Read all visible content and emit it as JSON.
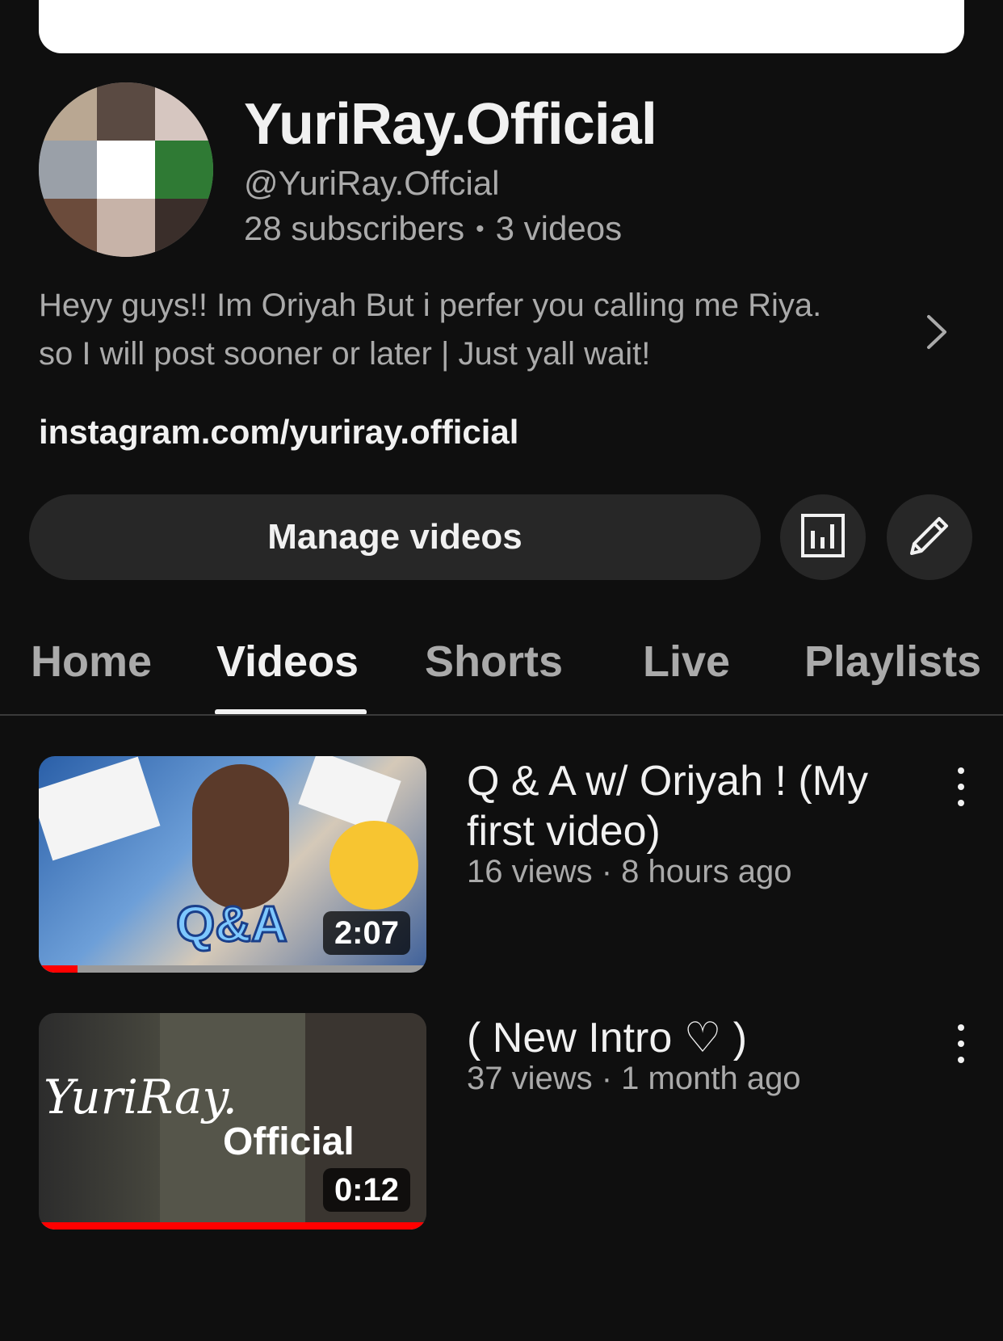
{
  "channel": {
    "name": "YuriRay.Official",
    "handle": "@YuriRay.Offcial",
    "subscribers": "28 subscribers",
    "separator": "•",
    "videos": "3 videos",
    "description": "Heyy guys!! Im Oriyah But i perfer you calling me Riya. so I will post sooner or later | Just yall wait!",
    "link": "instagram.com/yuriray.official"
  },
  "actions": {
    "manage_videos": "Manage videos",
    "analytics_icon": "analytics-icon",
    "edit_icon": "edit-pencil-icon"
  },
  "tabs": [
    {
      "label": "Home",
      "active": false
    },
    {
      "label": "Videos",
      "active": true
    },
    {
      "label": "Shorts",
      "active": false
    },
    {
      "label": "Live",
      "active": false
    },
    {
      "label": "Playlists",
      "active": false
    }
  ],
  "videos": [
    {
      "title": "Q & A w/ Oriyah ! (My first video)",
      "meta": "16 views · 8 hours ago",
      "duration": "2:07",
      "watched_fraction": 0.1,
      "thumb_text": "Q&A"
    },
    {
      "title": "( New Intro ♡ )",
      "meta": "37 views · 1 month ago",
      "duration": "0:12",
      "watched_fraction": 1.0,
      "thumb_text": "Official",
      "thumb_script": "YuriRay."
    }
  ],
  "colors": {
    "background": "#0f0f0f",
    "button": "#272727",
    "secondary_text": "#aaaaaa",
    "progress": "#ff0000"
  }
}
